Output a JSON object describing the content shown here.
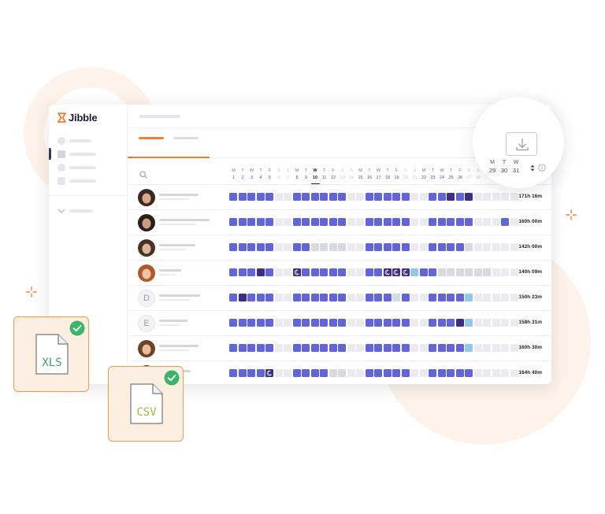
{
  "brand": {
    "name": "Jibble",
    "accent": "#f47c2c",
    "work_color": "#6264d9",
    "dark_color": "#3d2d86",
    "leave_color": "#8fc8f2"
  },
  "days": [
    {
      "l": "M",
      "n": "1"
    },
    {
      "l": "T",
      "n": "2"
    },
    {
      "l": "W",
      "n": "3"
    },
    {
      "l": "T",
      "n": "4"
    },
    {
      "l": "F",
      "n": "5"
    },
    {
      "l": "S",
      "n": "6"
    },
    {
      "l": "S",
      "n": "7"
    },
    {
      "l": "M",
      "n": "8"
    },
    {
      "l": "T",
      "n": "9"
    },
    {
      "l": "W",
      "n": "10"
    },
    {
      "l": "T",
      "n": "11"
    },
    {
      "l": "F",
      "n": "12"
    },
    {
      "l": "S",
      "n": "13"
    },
    {
      "l": "S",
      "n": "14"
    },
    {
      "l": "M",
      "n": "15"
    },
    {
      "l": "T",
      "n": "16"
    },
    {
      "l": "W",
      "n": "17"
    },
    {
      "l": "T",
      "n": "18"
    },
    {
      "l": "F",
      "n": "19"
    },
    {
      "l": "S",
      "n": "20"
    },
    {
      "l": "S",
      "n": "21"
    },
    {
      "l": "M",
      "n": "22"
    },
    {
      "l": "T",
      "n": "23"
    },
    {
      "l": "W",
      "n": "24"
    },
    {
      "l": "T",
      "n": "25"
    },
    {
      "l": "F",
      "n": "26"
    },
    {
      "l": "S",
      "n": "27"
    },
    {
      "l": "S",
      "n": "28"
    }
  ],
  "bubble_days": [
    {
      "l": "M",
      "n": "29"
    },
    {
      "l": "T",
      "n": "30"
    },
    {
      "l": "W",
      "n": "31"
    }
  ],
  "rows": [
    {
      "avatar": "photo",
      "total": "171h 16m",
      "cells": "WWWWWEEWWWWWWEEWWWWWEEWWDWDEEEEE"
    },
    {
      "avatar": "photo",
      "total": "160h 00m",
      "cells": "WWWWWEEWWWWWWEEWWWWWEEWWWWWEEEWE"
    },
    {
      "avatar": "photo",
      "total": "142h 00m",
      "cells": "WWWWWEEWWOOOOEEWWWWWEEWWWWOEEEEE"
    },
    {
      "avatar": "photo",
      "total": "140h 09m",
      "cells": "WWWDWEESWWWWWEEWWSSSLWWOOOOOOEEE"
    },
    {
      "avatar": "D",
      "total": "150h 23m",
      "cells": "WDWWWEEWWWWWWEEWWWOWEEWWWWLEEEEE"
    },
    {
      "avatar": "E",
      "total": "158h 31m",
      "cells": "WWWWWEEWWWWWWEEWWWWWEEWWWDLEEEEE"
    },
    {
      "avatar": "photo",
      "total": "160h 30m",
      "cells": "WWWWWEEWWWWWWEEWWWWWEEWWWWLEEEEE"
    },
    {
      "avatar": "photo",
      "total": "164h 40m",
      "cells": "WWWWSEEWWWWOOEEWWWWWEEWWWWWEEEEE"
    }
  ],
  "files": [
    {
      "label": "XLS",
      "color": "#3aa06a"
    },
    {
      "label": "CSV",
      "color": "#a4b83a"
    }
  ]
}
